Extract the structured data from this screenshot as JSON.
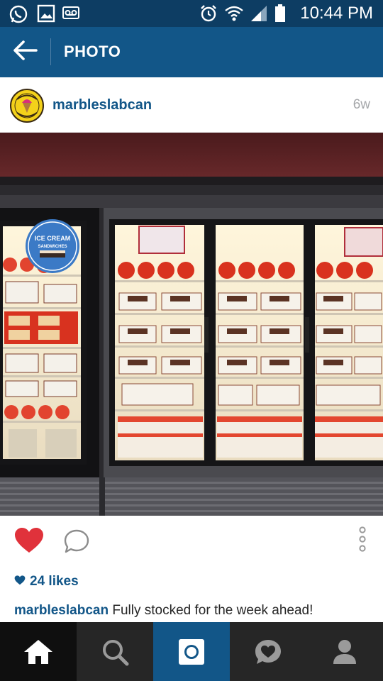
{
  "status_bar": {
    "time": "10:44 PM",
    "left_icons": [
      "whatsapp-icon",
      "gallery-icon",
      "voicemail-icon"
    ],
    "right_icons": [
      "alarm-icon",
      "wifi-icon",
      "signal-icon",
      "battery-icon"
    ]
  },
  "header": {
    "title": "PHOTO",
    "back_icon": "arrow-left-icon",
    "bg_color": "#125688"
  },
  "post": {
    "username": "marbleslabcan",
    "time_ago": "6w",
    "avatar_icon": "marble-slab-creamery-logo",
    "photo_subject": "ice cream freezer display",
    "likes": "24 likes",
    "caption_user": "marbleslabcan",
    "caption_text": " Fully stocked for the week ahead!"
  },
  "actions": {
    "like_icon": "heart-icon",
    "comment_icon": "comment-bubble-icon",
    "more_icon": "more-vertical-icon",
    "like_color": "#e0323b"
  },
  "photo_sign": {
    "line1": "ICE CREAM",
    "line2": "SANDWICHES"
  },
  "bottom_nav": {
    "items": [
      "home-icon",
      "search-icon",
      "camera-icon",
      "activity-icon",
      "profile-icon"
    ]
  }
}
